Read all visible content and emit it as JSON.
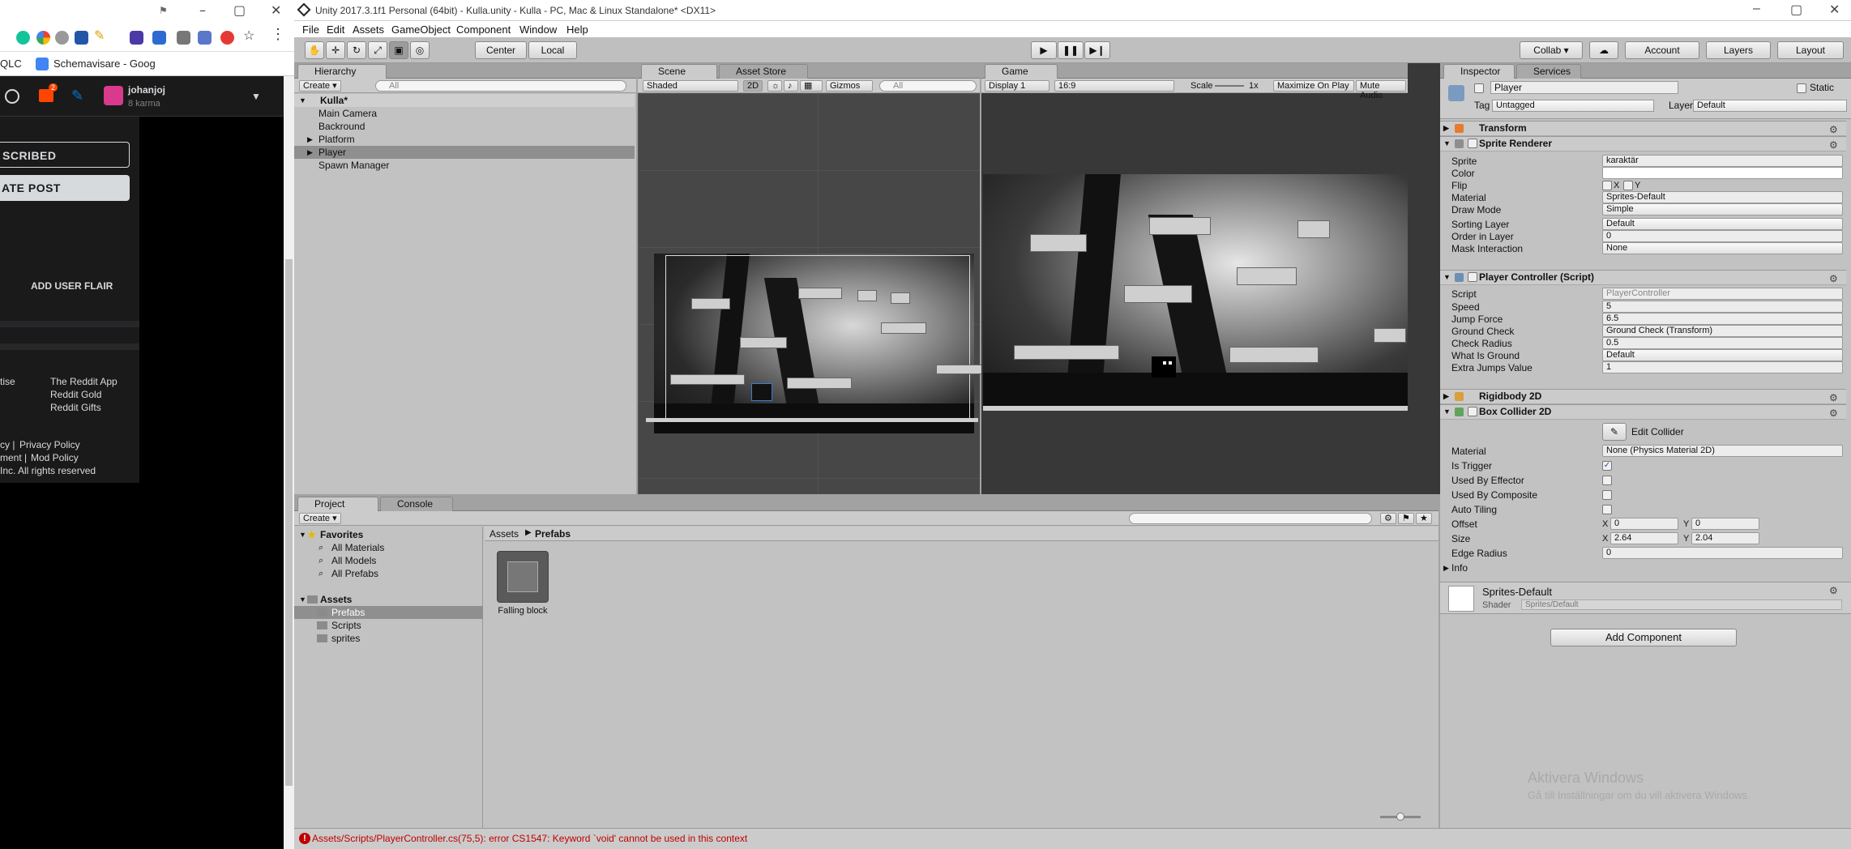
{
  "browser": {
    "window_controls": [
      "–",
      "▢",
      "✕"
    ],
    "extension_icons": [
      "grammarly-icon",
      "google-icon",
      "extension-icon",
      "trello-icon",
      "pen-icon",
      "video-icon",
      "tab-icon",
      "bag-icon",
      "cast-icon"
    ],
    "bookmarks": [
      "QLC",
      "Schemavisare - Goog"
    ],
    "reddit_user": {
      "name": "johanjoj",
      "karma": "8 karma",
      "notification_count": "2"
    },
    "buttons": {
      "subscribed": "SCRIBED",
      "create_post": "ATE POST",
      "add_flair": "ADD USER FLAIR"
    },
    "footer_links_left": [
      "tise",
      "",
      "",
      "cy |",
      "ment |",
      "Inc. All rights reserved"
    ],
    "footer_links_right": [
      "The Reddit App",
      "Reddit Gold",
      "Reddit Gifts"
    ],
    "policy": [
      "Privacy Policy",
      "Mod Policy"
    ]
  },
  "unity": {
    "title": "Unity 2017.3.1f1 Personal (64bit) - Kulla.unity - Kulla - PC, Mac & Linux Standalone* <DX11>",
    "menu": [
      "File",
      "Edit",
      "Assets",
      "GameObject",
      "Component",
      "Window",
      "Help"
    ],
    "toolbar": {
      "center": "Center",
      "local": "Local",
      "collab": "Collab ▾",
      "account": "Account",
      "layers": "Layers",
      "layout": "Layout"
    },
    "hierarchy": {
      "tab": "Hierarchy",
      "create": "Create ▾",
      "search": "All",
      "scene": "Kulla*",
      "items": [
        {
          "label": "Main Camera",
          "expandable": false,
          "selected": false
        },
        {
          "label": "Backround",
          "expandable": false,
          "selected": false
        },
        {
          "label": "Platform",
          "expandable": true,
          "selected": false
        },
        {
          "label": "Player",
          "expandable": true,
          "selected": true
        },
        {
          "label": "Spawn Manager",
          "expandable": false,
          "selected": false
        }
      ]
    },
    "scene": {
      "tab": "Scene",
      "store_tab": "Asset Store",
      "shading": "Shaded",
      "mode2d": "2D",
      "gizmos": "Gizmos",
      "search": "All"
    },
    "game": {
      "tab": "Game",
      "display": "Display 1",
      "aspect": "16:9",
      "scale_label": "Scale",
      "scale_value": "1x",
      "maximize": "Maximize On Play",
      "mute": "Mute Audio"
    },
    "project": {
      "tab": "Project",
      "console_tab": "Console",
      "create": "Create ▾",
      "favorites_label": "Favorites",
      "favorites": [
        "All Materials",
        "All Models",
        "All Prefabs"
      ],
      "assets_label": "Assets",
      "folders": [
        {
          "label": "Prefabs",
          "selected": true
        },
        {
          "label": "Scripts",
          "selected": false
        },
        {
          "label": "sprites",
          "selected": false
        }
      ],
      "breadcrumb": [
        "Assets",
        "Prefabs"
      ],
      "items": [
        "Falling block"
      ]
    },
    "inspector": {
      "tab": "Inspector",
      "services_tab": "Services",
      "object_name": "Player",
      "static": "Static",
      "tag_label": "Tag",
      "tag": "Untagged",
      "layer_label": "Layer",
      "layer": "Default",
      "transform": "Transform",
      "sprite_renderer": {
        "title": "Sprite Renderer",
        "rows": [
          [
            "Sprite",
            "karaktär"
          ],
          [
            "Color",
            ""
          ],
          [
            "Flip",
            ""
          ],
          [
            "Material",
            "Sprites-Default"
          ],
          [
            "Draw Mode",
            "Simple"
          ],
          [
            "Sorting Layer",
            "Default"
          ],
          [
            "Order in Layer",
            "0"
          ],
          [
            "Mask Interaction",
            "None"
          ]
        ],
        "flip_x": "X",
        "flip_y": "Y"
      },
      "player_controller": {
        "title": "Player Controller (Script)",
        "rows": [
          [
            "Script",
            "PlayerController"
          ],
          [
            "Speed",
            "5"
          ],
          [
            "Jump Force",
            "6.5"
          ],
          [
            "Ground Check",
            "Ground Check (Transform)"
          ],
          [
            "Check Radius",
            "0.5"
          ],
          [
            "What Is Ground",
            "Default"
          ],
          [
            "Extra Jumps Value",
            "1"
          ]
        ]
      },
      "rigidbody": "Rigidbody 2D",
      "box_collider": {
        "title": "Box Collider 2D",
        "edit_collider": "Edit Collider",
        "material_label": "Material",
        "material": "None (Physics Material 2D)",
        "checks": [
          [
            "Is Trigger",
            true
          ],
          [
            "Used By Effector",
            false
          ],
          [
            "Used By Composite",
            false
          ],
          [
            "Auto Tiling",
            false
          ]
        ],
        "offset_label": "Offset",
        "offset_x": "0",
        "offset_y": "0",
        "size_label": "Size",
        "size_x": "2.64",
        "size_y": "2.04",
        "edge_label": "Edge Radius",
        "edge": "0",
        "info": "Info",
        "x": "X",
        "y": "Y"
      },
      "material_name": "Sprites-Default",
      "shader_label": "Shader",
      "shader": "Sprites/Default",
      "add_component": "Add Component"
    },
    "watermark": {
      "title": "Aktivera Windows",
      "subtitle": "Gå till Inställningar om du vill aktivera Windows."
    },
    "status_error": "Assets/Scripts/PlayerController.cs(75,5): error CS1547: Keyword `void' cannot be used in this context"
  },
  "colors": {
    "error": "#c00000",
    "selection": "#3d7ad6",
    "reddit_orange": "#ff4500"
  }
}
